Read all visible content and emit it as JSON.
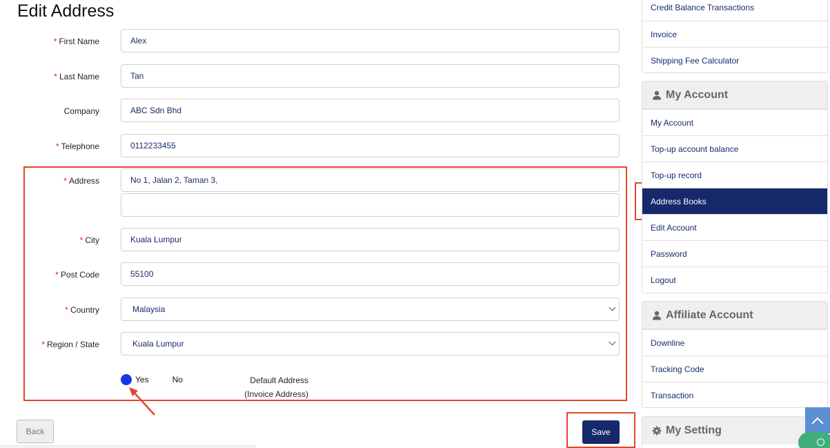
{
  "page": {
    "title": "Edit Address"
  },
  "form": {
    "required_mark": "*",
    "fields": {
      "first_name": {
        "label": "First Name",
        "value": "Alex"
      },
      "last_name": {
        "label": "Last Name",
        "value": "Tan"
      },
      "company": {
        "label": "Company",
        "value": "ABC Sdn Bhd"
      },
      "telephone": {
        "label": "Telephone",
        "value": "0112233455"
      },
      "address": {
        "label": "Address",
        "value": "No 1, Jalan 2, Taman 3,",
        "value2": ""
      },
      "city": {
        "label": "City",
        "value": "Kuala Lumpur"
      },
      "post_code": {
        "label": "Post Code",
        "value": "55100"
      },
      "country": {
        "label": "Country",
        "value": "Malaysia"
      },
      "region": {
        "label": "Region / State",
        "value": "Kuala Lumpur"
      }
    },
    "default_address": {
      "label_line1": "Default Address",
      "label_line2": "(Invoice Address)",
      "yes": "Yes",
      "no": "No",
      "selected": "Yes"
    },
    "back_label": "Back",
    "save_label": "Save"
  },
  "sidebar": {
    "top_items": [
      {
        "label": "Credit Balance Transactions"
      },
      {
        "label": "Invoice"
      },
      {
        "label": "Shipping Fee Calculator"
      }
    ],
    "my_account": {
      "heading": "My Account",
      "icon": "user-icon",
      "items": [
        {
          "label": "My Account"
        },
        {
          "label": "Top-up account balance"
        },
        {
          "label": "Top-up record"
        },
        {
          "label": "Address Books",
          "active": true
        },
        {
          "label": "Edit Account"
        },
        {
          "label": "Password"
        },
        {
          "label": "Logout"
        }
      ]
    },
    "affiliate": {
      "heading": "Affiliate Account",
      "icon": "user-icon",
      "items": [
        {
          "label": "Downline"
        },
        {
          "label": "Tracking Code"
        },
        {
          "label": "Transaction"
        }
      ]
    },
    "my_setting": {
      "heading": "My Setting",
      "icon": "gear-icon"
    }
  },
  "colors": {
    "primary": "#15296b",
    "radio": "#1a35e8",
    "required": "#e2231a",
    "annotation": "#e2452a"
  }
}
